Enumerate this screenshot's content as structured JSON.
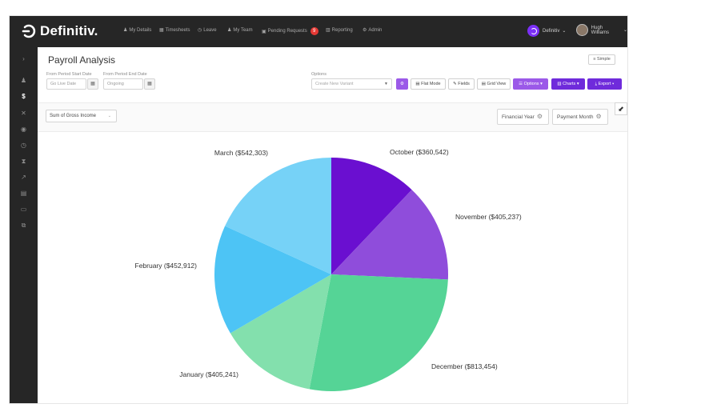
{
  "app": {
    "brand": "Definitiv.",
    "nav": [
      {
        "icon": "user-icon",
        "glyph": "♟",
        "label": "My Details"
      },
      {
        "icon": "calendar-icon",
        "glyph": "▦",
        "label": "Timesheets"
      },
      {
        "icon": "clock-icon",
        "glyph": "◷",
        "label": "Leave"
      },
      {
        "icon": "team-icon",
        "glyph": "♟",
        "label": "My Team"
      },
      {
        "icon": "inbox-icon",
        "glyph": "▣",
        "label": "Pending Requests"
      },
      {
        "icon": "chart-icon",
        "glyph": "▥",
        "label": "Reporting"
      },
      {
        "icon": "gear-icon",
        "glyph": "⚙",
        "label": "Admin"
      }
    ],
    "pending_count": "9",
    "company": "Definitiv",
    "user": "Hugh Williams"
  },
  "page": {
    "title": "Payroll Analysis",
    "simple_label": "Simple"
  },
  "filters": {
    "start_label": "From Period Start Date",
    "start_value": "Go Live Date",
    "end_label": "From Period End Date",
    "end_value": "Ongoing",
    "options_label": "Options",
    "options_placeholder": "Create New Variant"
  },
  "toolbar": {
    "flat_mode": "Flat Mode",
    "fields": "Fields",
    "grid_view": "Grid View",
    "options": "Options",
    "charts": "Charts",
    "export": "Export"
  },
  "pivot": {
    "measure": "Sum of Gross Income",
    "col_field": "Financial Year",
    "row_field": "Payment Month"
  },
  "colors": {
    "accent": "#6f2bdb",
    "topbar": "#262626"
  },
  "chart_data": {
    "type": "pie",
    "slices": [
      {
        "label": "October ($360,542)",
        "value": 360542,
        "color": "#6a0fd0"
      },
      {
        "label": "November ($405,237)",
        "value": 405237,
        "color": "#8f4ddb"
      },
      {
        "label": "December ($813,454)",
        "value": 813454,
        "color": "#55d496"
      },
      {
        "label": "January ($405,241)",
        "value": 405241,
        "color": "#83e0ad"
      },
      {
        "label": "February ($452,912)",
        "value": 452912,
        "color": "#4dc4f5"
      },
      {
        "label": "March ($542,303)",
        "value": 542303,
        "color": "#76d2f7"
      }
    ]
  }
}
